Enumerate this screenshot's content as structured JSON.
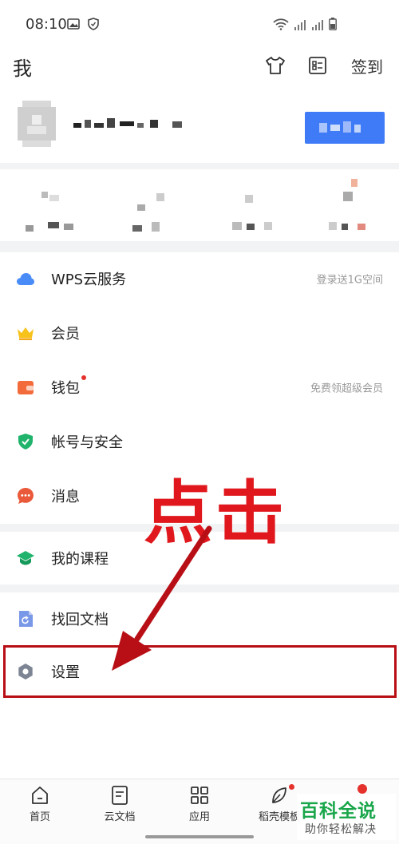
{
  "status_bar": {
    "time": "08:10"
  },
  "header": {
    "title": "我",
    "checkin_label": "签到"
  },
  "menu": {
    "cloud": {
      "label": "WPS云服务",
      "hint": "登录送1G空间"
    },
    "member": {
      "label": "会员"
    },
    "wallet": {
      "label": "钱包",
      "hint": "免费领超级会员"
    },
    "security": {
      "label": "帐号与安全"
    },
    "messages": {
      "label": "消息"
    },
    "courses": {
      "label": "我的课程"
    },
    "recover": {
      "label": "找回文档"
    },
    "settings": {
      "label": "设置"
    }
  },
  "annotation": {
    "text": "点击"
  },
  "bottom_nav": {
    "home": "首页",
    "cloud_docs": "云文档",
    "apps": "应用",
    "templates": "稻壳模板"
  },
  "watermark": {
    "title": "百科全说",
    "subtitle": "助你轻松解决"
  },
  "colors": {
    "accent_blue": "#3f7bf7",
    "crown_yellow": "#f7c21a",
    "wallet_orange": "#f36b3b",
    "shield_green": "#1fb36b",
    "message_red": "#ea5a3a",
    "annotation_red": "#e0171c",
    "watermark_green": "#1aa64a"
  }
}
